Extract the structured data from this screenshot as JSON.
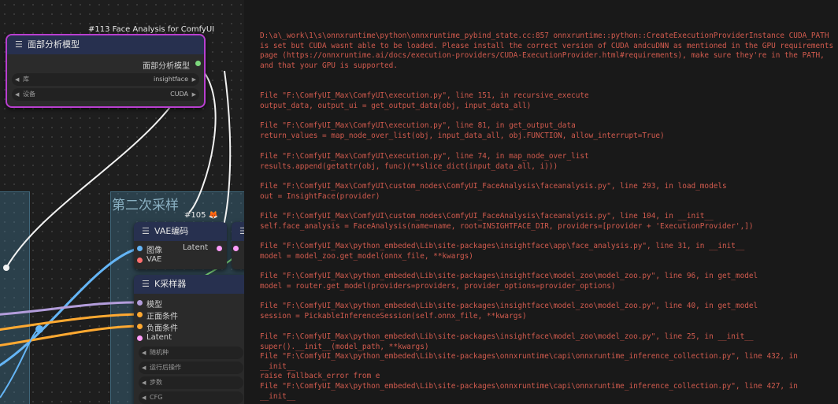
{
  "canvas": {
    "group_title": "第二次采样",
    "face_node": {
      "badge": "#113 Face Analysis for ComfyUI",
      "title": "面部分析模型",
      "output_label": "面部分析模型",
      "widgets": [
        {
          "label": "库",
          "value": "insightface"
        },
        {
          "label": "设备",
          "value": "CUDA"
        }
      ]
    },
    "vae_node": {
      "badge": "#105 🦊",
      "title": "VAE编码",
      "inputs": [
        "图像",
        "VAE"
      ],
      "output_label": "Latent"
    },
    "ksampler_node": {
      "title": "K采样器",
      "inputs": [
        "模型",
        "正面条件",
        "负面条件",
        "Latent"
      ],
      "widgets": [
        "随机种",
        "运行后操作",
        "步数",
        "CFG"
      ]
    },
    "colors": {
      "node_header": "#27304f",
      "selected_border": "#b93fd0",
      "vae_port": "#ff6e6e",
      "image_port": "#64b5f6",
      "model_port": "#b39ddb",
      "cond_port": "#ffa931",
      "latent_port": "#ff9cf9",
      "output_port": "#7dd87d"
    }
  },
  "console": {
    "text_color": "#d25b4e",
    "lines": [
      "D:\\a\\_work\\1\\s\\onnxruntime\\python\\onnxruntime_pybind_state.cc:857 onnxruntime::python::CreateExecutionProviderInstance CUDA_PATH",
      "is set but CUDA wasnt able to be loaded. Please install the correct version of CUDA andcuDNN as mentioned in the GPU requirements",
      "page (https://onnxruntime.ai/docs/execution-providers/CUDA-ExecutionProvider.html#requirements), make sure they're in the PATH,",
      "and that your GPU is supported.",
      "File \"F:\\ComfyUI_Max\\ComfyUI\\execution.py\", line 151, in recursive_execute",
      "output_data, output_ui = get_output_data(obj, input_data_all)",
      "File \"F:\\ComfyUI_Max\\ComfyUI\\execution.py\", line 81, in get_output_data",
      "return_values = map_node_over_list(obj, input_data_all, obj.FUNCTION, allow_interrupt=True)",
      "File \"F:\\ComfyUI_Max\\ComfyUI\\execution.py\", line 74, in map_node_over_list",
      "results.append(getattr(obj, func)(**slice_dict(input_data_all, i)))",
      "File \"F:\\ComfyUI_Max\\ComfyUI\\custom_nodes\\ComfyUI_FaceAnalysis\\faceanalysis.py\", line 293, in load_models",
      "out = InsightFace(provider)",
      "File \"F:\\ComfyUI_Max\\ComfyUI\\custom_nodes\\ComfyUI_FaceAnalysis\\faceanalysis.py\", line 104, in __init__",
      "self.face_analysis = FaceAnalysis(name=name, root=INSIGHTFACE_DIR, providers=[provider + 'ExecutionProvider',])",
      "File \"F:\\ComfyUI_Max\\python_embeded\\Lib\\site-packages\\insightface\\app\\face_analysis.py\", line 31, in __init__",
      "model = model_zoo.get_model(onnx_file, **kwargs)",
      "File \"F:\\ComfyUI_Max\\python_embeded\\Lib\\site-packages\\insightface\\model_zoo\\model_zoo.py\", line 96, in get_model",
      "model = router.get_model(providers=providers, provider_options=provider_options)",
      "File \"F:\\ComfyUI_Max\\python_embeded\\Lib\\site-packages\\insightface\\model_zoo\\model_zoo.py\", line 40, in get_model",
      "session = PickableInferenceSession(self.onnx_file, **kwargs)",
      "File \"F:\\ComfyUI_Max\\python_embeded\\Lib\\site-packages\\insightface\\model_zoo\\model_zoo.py\", line 25, in __init__",
      "super().__init__(model_path, **kwargs)",
      "File \"F:\\ComfyUI_Max\\python_embeded\\Lib\\site-packages\\onnxruntime\\capi\\onnxruntime_inference_collection.py\", line 432, in",
      "__init__",
      "raise fallback_error from e",
      "File \"F:\\ComfyUI_Max\\python_embeded\\Lib\\site-packages\\onnxruntime\\capi\\onnxruntime_inference_collection.py\", line 427, in",
      "__init__"
    ]
  }
}
